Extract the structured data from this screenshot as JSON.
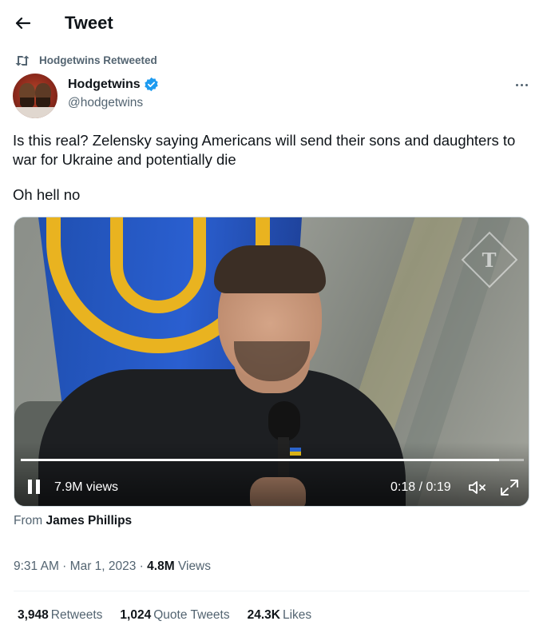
{
  "header": {
    "title": "Tweet"
  },
  "retweet": {
    "text": "Hodgetwins Retweeted"
  },
  "author": {
    "name": "Hodgetwins",
    "handle": "@hodgetwins"
  },
  "tweet": {
    "text": "Is this real? Zelensky saying Americans will send their sons and daughters to war for Ukraine and potentially die",
    "text2": "Oh hell no"
  },
  "video": {
    "views": "7.9M views",
    "time": "0:18 / 0:19",
    "progress": 0.95
  },
  "from": {
    "prefix": "From",
    "name": "James Phillips"
  },
  "meta": {
    "time": "9:31 AM",
    "date": "Mar 1, 2023",
    "views_count": "4.8M",
    "views_label": "Views"
  },
  "stats": {
    "retweets_count": "3,948",
    "retweets_label": "Retweets",
    "quotes_count": "1,024",
    "quotes_label": "Quote Tweets",
    "likes_count": "24.3K",
    "likes_label": "Likes"
  },
  "colors": {
    "verified": "#1d9bf0",
    "secondary_text": "#536471",
    "primary_text": "#0f1419"
  },
  "icons": [
    "back-arrow-icon",
    "retweet-icon",
    "verified-badge-icon",
    "more-icon",
    "pause-icon",
    "mute-icon",
    "expand-icon"
  ]
}
